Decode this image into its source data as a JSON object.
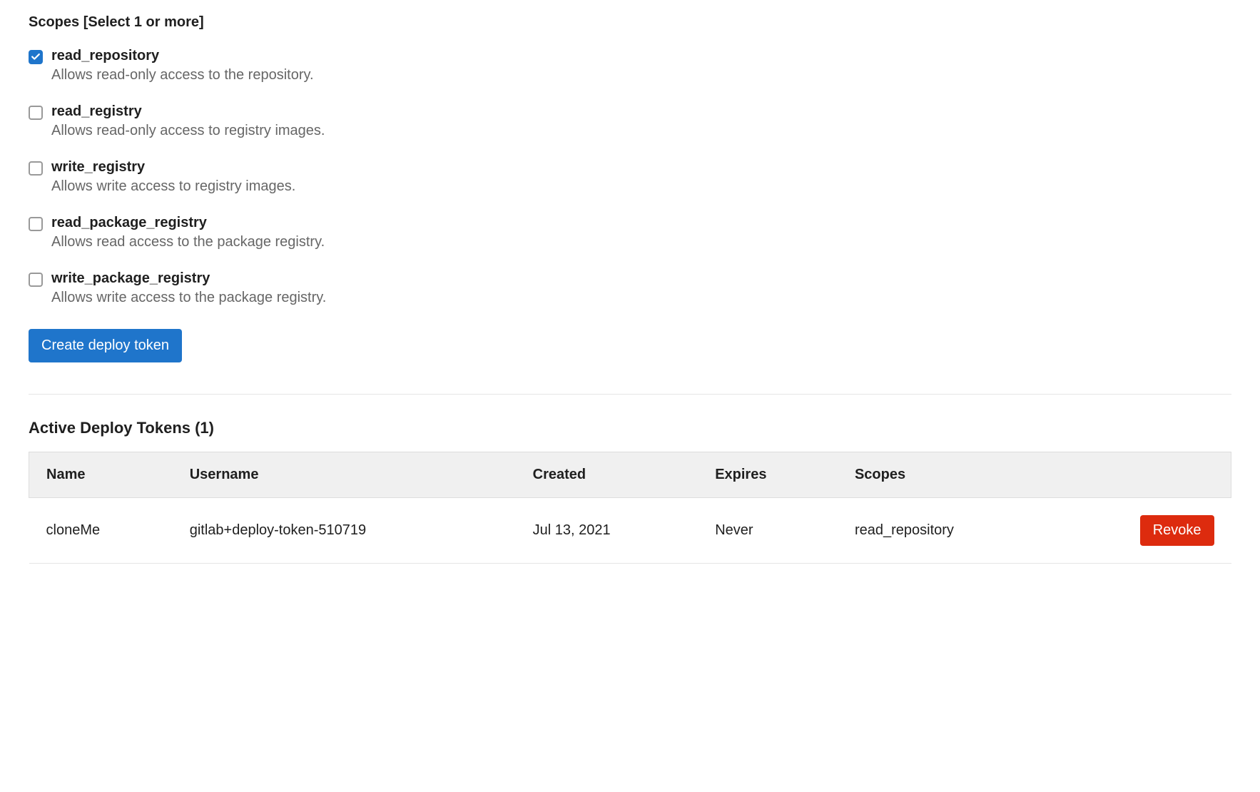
{
  "scopes": {
    "heading": "Scopes [Select 1 or more]",
    "items": [
      {
        "name": "read_repository",
        "desc": "Allows read-only access to the repository.",
        "checked": true
      },
      {
        "name": "read_registry",
        "desc": "Allows read-only access to registry images.",
        "checked": false
      },
      {
        "name": "write_registry",
        "desc": "Allows write access to registry images.",
        "checked": false
      },
      {
        "name": "read_package_registry",
        "desc": "Allows read access to the package registry.",
        "checked": false
      },
      {
        "name": "write_package_registry",
        "desc": "Allows write access to the package registry.",
        "checked": false
      }
    ],
    "create_button": "Create deploy token"
  },
  "active_tokens": {
    "heading": "Active Deploy Tokens (1)",
    "columns": {
      "name": "Name",
      "username": "Username",
      "created": "Created",
      "expires": "Expires",
      "scopes": "Scopes"
    },
    "rows": [
      {
        "name": "cloneMe",
        "username": "gitlab+deploy-token-510719",
        "created": "Jul 13, 2021",
        "expires": "Never",
        "scopes": "read_repository",
        "revoke": "Revoke"
      }
    ]
  }
}
